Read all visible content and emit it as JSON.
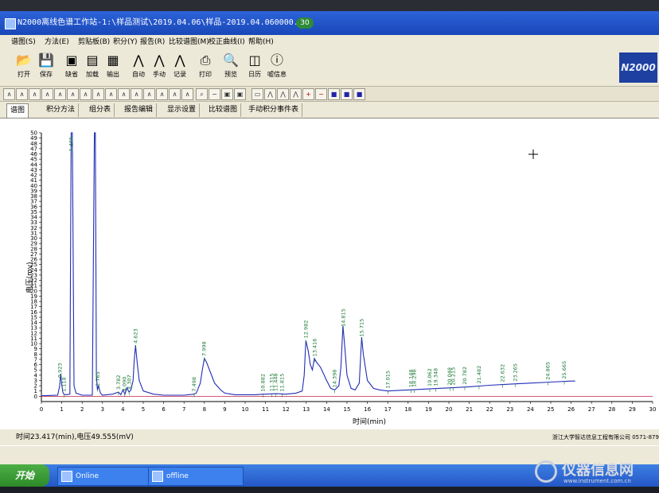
{
  "window": {
    "title": "N2000离线色谱工作站-1:\\样品测试\\2019.04.06\\样品-2019.04.060000.org",
    "badge": "30"
  },
  "menu": [
    "谱图(S)",
    "方法(E)",
    "剪贴板(B)",
    "积分(Y)",
    "报告(R)",
    "比较谱图(M)",
    "校正曲线(I)",
    "帮助(H)"
  ],
  "toolbar": [
    {
      "label": "打开",
      "icon": "open-icon"
    },
    {
      "label": "保存",
      "icon": "save-icon"
    },
    {
      "label": "缺省",
      "icon": "default-icon"
    },
    {
      "label": "加载",
      "icon": "load-icon"
    },
    {
      "label": "输出",
      "icon": "export-icon"
    },
    {
      "label": "自动",
      "icon": "auto-icon"
    },
    {
      "label": "手动",
      "icon": "manual-icon"
    },
    {
      "label": "记录",
      "icon": "record-icon"
    },
    {
      "label": "打印",
      "icon": "print-icon"
    },
    {
      "label": "预览",
      "icon": "preview-icon"
    },
    {
      "label": "日历",
      "icon": "calendar-icon"
    },
    {
      "label": "嘘信息",
      "icon": "info-icon"
    }
  ],
  "brand": "N2000",
  "tabs": [
    "谱图",
    "积分方法",
    "组分表",
    "报告编辑",
    "显示设置",
    "比较谱图",
    "手动积分事件表"
  ],
  "status": {
    "left": "时间23.417(min),电压49.555(mV)",
    "right": "浙江大学智达信息工程有限公司 0571-8799117"
  },
  "taskbar": {
    "start": "开始",
    "tasks": [
      "Online",
      "offline"
    ]
  },
  "watermark": {
    "title": "仪器信息网",
    "url": "www.instrument.com.cn"
  },
  "chart_data": {
    "type": "line",
    "xlabel": "时间(min)",
    "ylabel": "电压(mv)",
    "xlim": [
      0,
      30
    ],
    "ylim": [
      -1,
      50
    ],
    "xticks": [
      0,
      1,
      2,
      3,
      4,
      5,
      6,
      7,
      8,
      9,
      10,
      11,
      12,
      13,
      14,
      15,
      16,
      17,
      18,
      19,
      20,
      21,
      22,
      23,
      24,
      25,
      26,
      27,
      28,
      29,
      30
    ],
    "yticks": [
      0,
      1,
      2,
      3,
      4,
      5,
      6,
      7,
      8,
      9,
      10,
      11,
      12,
      13,
      14,
      15,
      16,
      17,
      18,
      19,
      20,
      21,
      22,
      23,
      24,
      25,
      26,
      27,
      28,
      29,
      30,
      31,
      32,
      33,
      34,
      35,
      36,
      37,
      38,
      39,
      40,
      41,
      42,
      43,
      44,
      45,
      46,
      47,
      48,
      49,
      50
    ],
    "series": [
      {
        "color": "#1f2db5",
        "x": [
          0,
          0.8,
          0.9,
          0.95,
          1.0,
          1.05,
          1.1,
          1.2,
          1.4,
          1.46,
          1.52,
          1.6,
          1.7,
          2.0,
          2.5,
          2.6,
          2.65,
          2.7,
          2.75,
          2.8,
          2.9,
          3.0,
          3.2,
          3.5,
          3.78,
          3.9,
          4.0,
          4.1,
          4.2,
          4.3,
          4.4,
          4.5,
          4.55,
          4.62,
          4.7,
          4.8,
          5.0,
          5.5,
          6.0,
          7.0,
          7.49,
          7.6,
          7.8,
          7.9,
          8.0,
          8.1,
          8.3,
          8.5,
          8.8,
          9.0,
          9.5,
          10.0,
          10.5,
          10.88,
          11.0,
          11.5,
          12.0,
          12.5,
          12.8,
          12.9,
          12.98,
          13.1,
          13.2,
          13.3,
          13.4,
          13.5,
          13.7,
          14.0,
          14.2,
          14.4,
          14.6,
          14.7,
          14.8,
          14.9,
          15.0,
          15.2,
          15.4,
          15.6,
          15.72,
          15.8,
          16.0,
          16.3,
          16.6,
          17.0,
          18.0,
          19.0,
          20.0,
          21.0,
          22.0,
          23.0,
          24.0,
          25.0,
          26.0,
          26.2
        ],
        "y": [
          0.1,
          0.2,
          2.0,
          4.3,
          2.2,
          0.8,
          0.4,
          0.3,
          0.4,
          50,
          50,
          2.0,
          0.6,
          0.2,
          0.2,
          50,
          50,
          4.0,
          1.2,
          2.0,
          0.6,
          0.2,
          0.3,
          0.4,
          0.8,
          0.3,
          1.2,
          0.4,
          1.6,
          0.8,
          1.2,
          3.0,
          6.5,
          9.7,
          6.5,
          3.0,
          1.0,
          0.4,
          0.2,
          0.2,
          0.4,
          0.6,
          2.5,
          5.0,
          7.2,
          6.5,
          4.5,
          2.5,
          1.2,
          0.6,
          0.3,
          0.3,
          0.3,
          0.4,
          0.4,
          0.5,
          0.4,
          0.6,
          1.0,
          4.0,
          10.6,
          8.5,
          6.0,
          5.0,
          7.2,
          6.5,
          5.5,
          3.0,
          1.5,
          1.2,
          2.0,
          5.5,
          13.4,
          9.0,
          4.0,
          1.5,
          1.2,
          2.5,
          11.2,
          8.0,
          3.0,
          1.5,
          1.2,
          1.0,
          1.2,
          1.4,
          1.6,
          1.8,
          2.1,
          2.3,
          2.5,
          2.7,
          2.9,
          2.9
        ]
      },
      {
        "color": "#c2224a",
        "x": [
          0,
          30
        ],
        "y": [
          0,
          0
        ]
      }
    ],
    "annotations": [
      {
        "x": 0.923,
        "label": "0.923"
      },
      {
        "x": 1.117,
        "label": "1.118"
      },
      {
        "x": 1.465,
        "label": "1.465"
      },
      {
        "x": 2.765,
        "label": "2.765"
      },
      {
        "x": 3.782,
        "label": "3.782"
      },
      {
        "x": 4.09,
        "label": "4.090"
      },
      {
        "x": 4.307,
        "label": "4.307"
      },
      {
        "x": 4.623,
        "label": "4.623"
      },
      {
        "x": 7.498,
        "label": "7.498"
      },
      {
        "x": 7.998,
        "label": "7.998"
      },
      {
        "x": 10.882,
        "label": "10.882"
      },
      {
        "x": 11.315,
        "label": "11.315"
      },
      {
        "x": 11.5,
        "label": "11.448"
      },
      {
        "x": 11.815,
        "label": "11.815"
      },
      {
        "x": 12.982,
        "label": "12.982"
      },
      {
        "x": 13.416,
        "label": "13.416"
      },
      {
        "x": 14.398,
        "label": "14.398"
      },
      {
        "x": 14.815,
        "label": "14.815"
      },
      {
        "x": 15.715,
        "label": "15.715"
      },
      {
        "x": 17.015,
        "label": "17.015"
      },
      {
        "x": 18.148,
        "label": "18.148"
      },
      {
        "x": 18.298,
        "label": "18.298"
      },
      {
        "x": 19.062,
        "label": "19.062"
      },
      {
        "x": 19.348,
        "label": "19.348"
      },
      {
        "x": 20.048,
        "label": "20.048"
      },
      {
        "x": 20.215,
        "label": "20.215"
      },
      {
        "x": 20.782,
        "label": "20.782"
      },
      {
        "x": 21.482,
        "label": "21.482"
      },
      {
        "x": 22.632,
        "label": "22.632"
      },
      {
        "x": 23.265,
        "label": "23.265"
      },
      {
        "x": 24.865,
        "label": "24.865"
      },
      {
        "x": 25.665,
        "label": "25.665"
      }
    ]
  }
}
